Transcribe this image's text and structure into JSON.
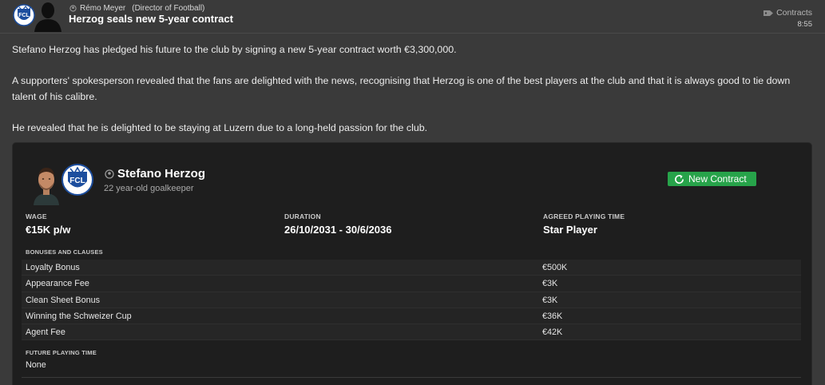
{
  "header": {
    "sender_name": "Rémo Meyer",
    "sender_role": "(Director of Football)",
    "headline": "Herzog seals new 5-year contract",
    "category": "Contracts",
    "time": "8:55",
    "badge_text": "FCL"
  },
  "article": {
    "paragraphs": [
      "Stefano Herzog has pledged his future to the club by signing a new 5-year contract worth €3,300,000.",
      "A supporters' spokesperson revealed that the fans are delighted with the news, recognising that Herzog is one of the best players at the club and that it is always good to tie down",
      "talent of his calibre.",
      "He revealed that he is delighted to be staying at Luzern due to a long-held passion for the club."
    ]
  },
  "card": {
    "player_name": "Stefano Herzog",
    "player_desc": "22 year-old goalkeeper",
    "badge_text": "FCL",
    "new_contract_label": "New Contract",
    "wage_label": "WAGE",
    "wage_value": "€15K p/w",
    "duration_label": "DURATION",
    "duration_value": "26/10/2031 - 30/6/2036",
    "playing_time_label": "AGREED PLAYING TIME",
    "playing_time_value": "Star Player",
    "bonuses_label": "BONUSES AND CLAUSES",
    "clauses": [
      {
        "name": "Loyalty Bonus",
        "value": "€500K"
      },
      {
        "name": "Appearance Fee",
        "value": "€3K"
      },
      {
        "name": "Clean Sheet Bonus",
        "value": "€3K"
      },
      {
        "name": "Winning the Schweizer Cup",
        "value": "€36K"
      },
      {
        "name": "Agent Fee",
        "value": "€42K"
      }
    ],
    "future_label": "FUTURE PLAYING TIME",
    "future_value": "None"
  },
  "colors": {
    "background": "#3a3a3a",
    "card": "#1e1e1e",
    "accent_green": "#27a34a",
    "badge_blue": "#1d4e9e"
  }
}
